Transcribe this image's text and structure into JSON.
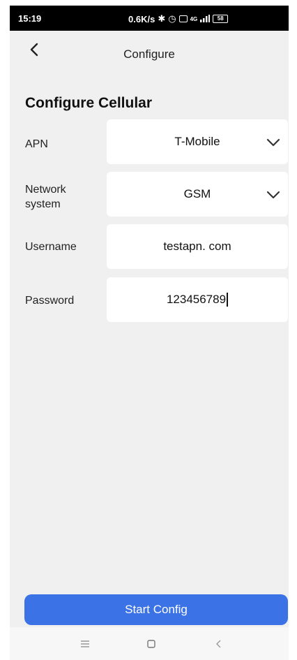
{
  "status_bar": {
    "time": "15:19",
    "network_speed": "0.6K/s",
    "network_type": "4G",
    "battery": "58"
  },
  "header": {
    "title": "Configure"
  },
  "section_title": "Configure Cellular",
  "form": {
    "apn": {
      "label": "APN",
      "value": "T-Mobile"
    },
    "network_system": {
      "label_line1": "Network",
      "label_line2": "system",
      "value": "GSM"
    },
    "username": {
      "label": "Username",
      "value": "testapn. com"
    },
    "password": {
      "label": "Password",
      "value": "123456789"
    }
  },
  "start_button_label": "Start Config",
  "colors": {
    "accent": "#3b72e5",
    "background": "#f0f0f0",
    "field": "#ffffff"
  }
}
